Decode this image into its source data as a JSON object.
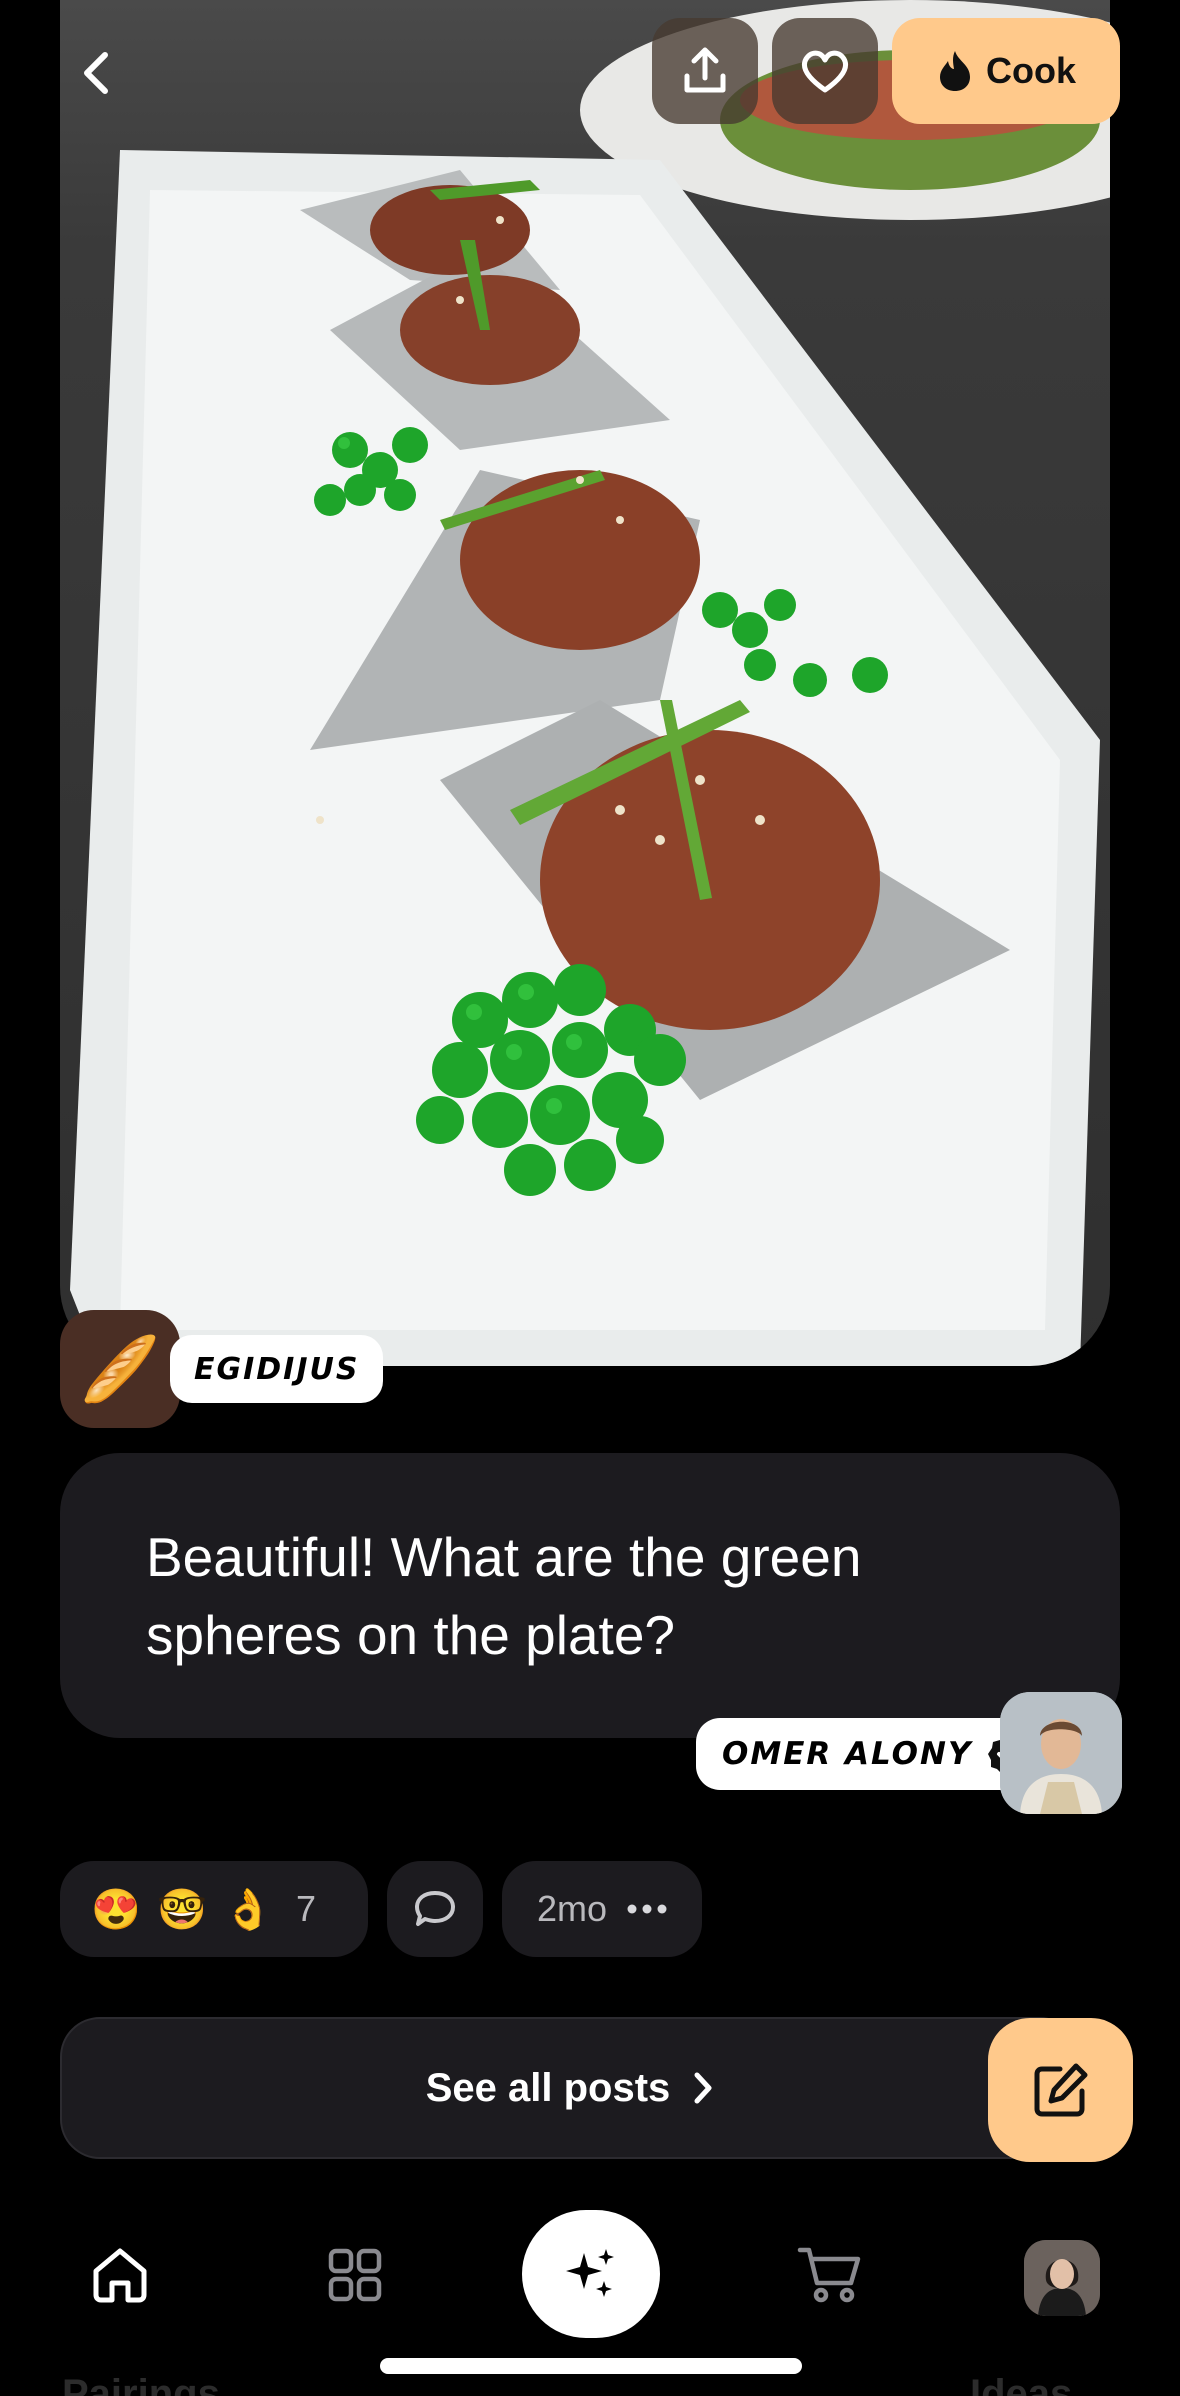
{
  "header": {
    "back_icon": "chevron-left-icon",
    "share_icon": "share-upload-icon",
    "like_icon": "heart-icon",
    "cook_label": "Cook",
    "cook_icon": "flame-icon"
  },
  "post": {
    "author_name": "EGIDIJUS",
    "author_avatar_emoji": "🥖",
    "comment_text": "Beautiful! What are the green spheres on the plate?",
    "replier_name": "OMER ALONY",
    "replier_verified_icon": "verified-badge-icon"
  },
  "reactions": {
    "emojis": [
      "😍",
      "🤓",
      "👌"
    ],
    "count": "7",
    "comment_icon": "chat-bubble-icon",
    "age": "2mo",
    "more_icon": "ellipsis-icon"
  },
  "actions": {
    "see_all_label": "See all posts",
    "edit_icon": "edit-compose-icon"
  },
  "colors": {
    "accent": "#ffc98b",
    "card": "#1c1b1f",
    "background": "#000000"
  },
  "nav": {
    "items": [
      "home-icon",
      "grid-icon",
      "sparkles-icon",
      "cart-icon",
      "profile-avatar"
    ]
  },
  "peek": {
    "left": "Pairings",
    "right": "Ideas"
  }
}
